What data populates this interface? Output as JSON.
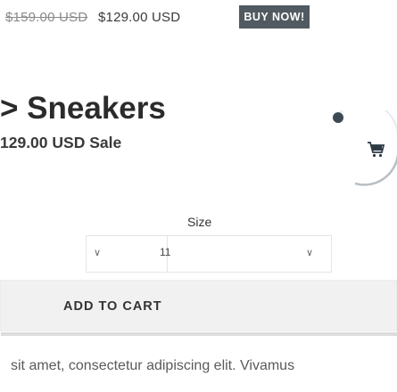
{
  "sticky_bar": {
    "compare_price": "$159.00 USD",
    "price": "$129.00 USD",
    "buy_label": "BUY NOW!"
  },
  "product": {
    "title": "> Sneakers",
    "price_line": "129.00 USD Sale"
  },
  "options": {
    "size_label": "Size",
    "size_value": "11"
  },
  "cart": {
    "add_label": "ADD TO CART"
  },
  "description": {
    "text": "sit amet, consectetur adipiscing elit. Vivamus"
  },
  "icons": {
    "cart": "cart-icon",
    "chevron": "chevron-down-icon"
  }
}
